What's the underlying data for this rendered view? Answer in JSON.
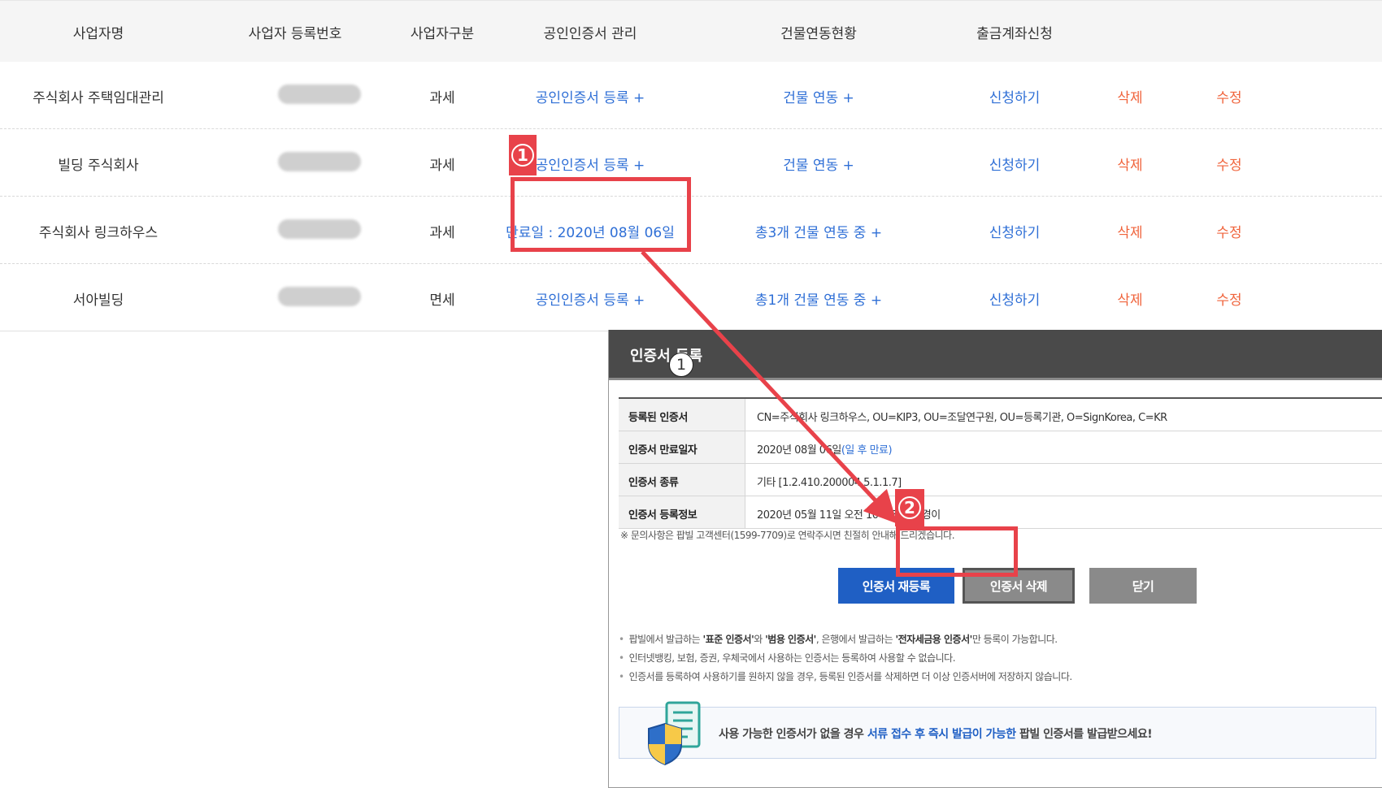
{
  "table": {
    "headers": [
      "사업자명",
      "사업자 등록번호",
      "사업자구분",
      "공인인증서 관리",
      "건물연동현황",
      "출금계좌신청"
    ],
    "rows": [
      {
        "name": "주식회사 주택임대관리",
        "type": "과세",
        "cert": "공인인증서 등록 +",
        "building": "건물 연동 +",
        "account": "신청하기",
        "delete": "삭제",
        "edit": "수정"
      },
      {
        "name": "빌딩 주식회사",
        "type": "과세",
        "cert": "공인인증서 등록 +",
        "building": "건물 연동 +",
        "account": "신청하기",
        "delete": "삭제",
        "edit": "수정"
      },
      {
        "name": "주식회사 링크하우스",
        "type": "과세",
        "cert": "만료일 : 2020년 08월 06일",
        "building": "총3개 건물 연동 중 +",
        "account": "신청하기",
        "delete": "삭제",
        "edit": "수정"
      },
      {
        "name": "서아빌딩",
        "type": "면세",
        "cert": "공인인증서 등록 +",
        "building": "총1개 건물 연동 중 +",
        "account": "신청하기",
        "delete": "삭제",
        "edit": "수정"
      }
    ]
  },
  "annotations": {
    "step1": "1",
    "step2": "2",
    "step1_small": "1"
  },
  "modal": {
    "title": "인증서 등록",
    "info": [
      {
        "label": "등록된 인증서",
        "value": "CN=주식회사 링크하우스, OU=KIP3, OU=조달연구원, OU=등록기관, O=SignKorea, C=KR"
      },
      {
        "label": "인증서 만료일자",
        "value": "2020년 08월 06일",
        "value_extra": "(일 후 만료)"
      },
      {
        "label": "인증서 종류",
        "value": "기타 [1.2.410.200004.5.1.1.7]"
      },
      {
        "label": "인증서 등록정보",
        "value": "2020년 05월 11일 오전 10시 59분 / 경이"
      }
    ],
    "note": "※ 문의사항은 팝빌 고객센터(1599-7709)로 연락주시면 친절히 안내해 드리겠습니다.",
    "buttons": {
      "reregister": "인증서 재등록",
      "delete": "인증서 삭제",
      "close": "닫기"
    },
    "bullets": {
      "b1_pre": "팝빌에서 발급하는 ",
      "b1_std": "'표준 인증서'",
      "b1_mid1": "와 ",
      "b1_gen": "'범용 인증서'",
      "b1_mid2": ", 은행에서 발급하는 ",
      "b1_tax": "'전자세금용 인증서'",
      "b1_post": "만 등록이 가능합니다.",
      "b2": "인터넷뱅킹, 보험, 증권, 우체국에서 사용하는 인증서는 등록하여 사용할 수 없습니다.",
      "b3": "인증서를 등록하여 사용하기를 원하지 않을 경우, 등록된 인증서를 삭제하면 더 이상 인증서버에 저장하지 않습니다."
    },
    "promo": {
      "pre": "사용 가능한 인증서가 없을 경우 ",
      "hl": "서류 접수 후 즉시 발급이 가능한",
      "post": " 팝빌 인증서를 발급받으세요!"
    }
  },
  "colors": {
    "link_blue": "#2f6fd6",
    "action_red": "#f0643c",
    "annotation_red": "#e8424a",
    "primary_button": "#1f5fc4"
  }
}
